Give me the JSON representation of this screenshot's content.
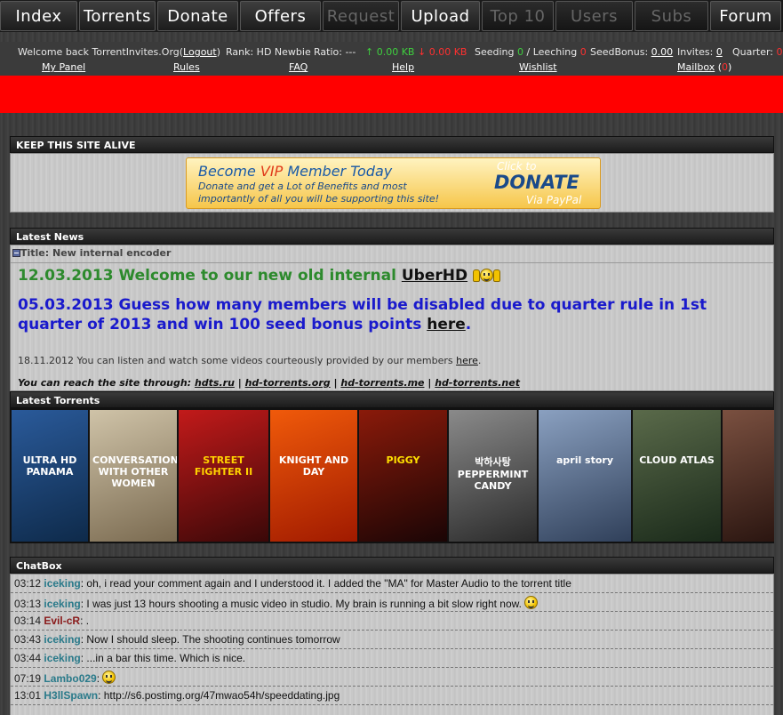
{
  "nav": {
    "tabs": [
      {
        "label": "Index",
        "dim": false
      },
      {
        "label": "Torrents",
        "dim": false
      },
      {
        "label": "Donate",
        "dim": false
      },
      {
        "label": "Offers",
        "dim": false
      },
      {
        "label": "Request",
        "dim": true
      },
      {
        "label": "Upload",
        "dim": false
      },
      {
        "label": "Top 10",
        "dim": true
      },
      {
        "label": "Users",
        "dim": true
      },
      {
        "label": "Subs",
        "dim": true
      },
      {
        "label": "Forum",
        "dim": false
      }
    ]
  },
  "userbar": {
    "welcome": "Welcome back TorrentInvites.Org(",
    "logout": "Logout",
    "welcome_end": ")",
    "my_panel": "My Panel",
    "rank": "Rank: HD Newbie",
    "rules": "Rules",
    "ratio": "Ratio: ---",
    "faq": "FAQ",
    "upload": "↑ 0.00 KB",
    "help": "Help",
    "download": "↓ 0.00 KB",
    "seeding_label": "Seeding",
    "seeding_value": "0",
    "leeching_label": "/ Leeching",
    "leeching_value": "0",
    "wishlist": "Wishlist",
    "seedbonus_label": "SeedBonus:",
    "seedbonus_value": "0.00",
    "invites_label": "Invites:",
    "invites_value": "0",
    "mailbox": "Mailbox",
    "mailbox_count": "0",
    "quarter_label": "Quarter:",
    "quarter_value": "0"
  },
  "keepalive": {
    "header": "KEEP THIS SITE ALIVE",
    "vip_prefix": "Become ",
    "vip_word": "VIP",
    "vip_suffix": " Member Today",
    "vip_text": "Donate and get a Lot of Benefits and most importantly of all you will be supporting this site!",
    "click_to": "Click to",
    "donate": "DONATE",
    "via_paypal": "Via PayPal"
  },
  "news": {
    "header": "Latest News",
    "title_label": "Title: New internal encoder",
    "line1_text": "12.03.2013 Welcome to our new old internal ",
    "line1_link": "UberHD",
    "line2_text": "05.03.2013 Guess how many members will be disabled due to quarter rule in 1st quarter of 2013 and win 100 seed bonus points ",
    "line2_link": "here",
    "line2_end": ".",
    "line3_text": "18.11.2012 You can listen and watch some videos courteously provided by our members ",
    "line3_link": "here",
    "line3_end": ".",
    "reach_label": "You can reach the site through: ",
    "reach_links": [
      "hdts.ru",
      "hd-torrents.org",
      "hd-torrents.me",
      "hd-torrents.net"
    ],
    "separator": " | "
  },
  "torrents": {
    "header": "Latest Torrents",
    "posters": [
      {
        "title": "ULTRA HD PANAMA",
        "colors": [
          "#2a5a9a",
          "#0e2a4a"
        ],
        "text_color": "#ffffff"
      },
      {
        "title": "CONVERSATION(S) WITH OTHER WOMEN",
        "colors": [
          "#cfc3a8",
          "#7a6a50"
        ],
        "text_color": "#ffffff"
      },
      {
        "title": "STREET FIGHTER II",
        "colors": [
          "#c21a1a",
          "#3a0808"
        ],
        "text_color": "#ffd200"
      },
      {
        "title": "KNIGHT AND DAY",
        "colors": [
          "#f05a0a",
          "#a01a00"
        ],
        "text_color": "#ffffff"
      },
      {
        "title": "PIGGY",
        "colors": [
          "#8a1a0a",
          "#1a0505"
        ],
        "text_color": "#ffe000"
      },
      {
        "title": "박하사탕 PEPPERMINT CANDY",
        "colors": [
          "#8a8a8a",
          "#2a2a2a"
        ],
        "text_color": "#ffffff"
      },
      {
        "title": "april story",
        "colors": [
          "#8aa0c0",
          "#30405a"
        ],
        "text_color": "#ffffff"
      },
      {
        "title": "CLOUD ATLAS",
        "colors": [
          "#5a6a4a",
          "#1a2a1a"
        ],
        "text_color": "#ffffff"
      },
      {
        "title": "",
        "colors": [
          "#7a5040",
          "#2a1510"
        ],
        "text_color": "#ffffff"
      }
    ]
  },
  "chat": {
    "header": "ChatBox",
    "messages": [
      {
        "time": "03:12",
        "user": "iceking",
        "msg": "oh, i read your comment again and I understood it. I added the \"MA\" for Master Audio to the torrent title",
        "smiley": false,
        "color": "teal"
      },
      {
        "time": "03:13",
        "user": "iceking",
        "msg": "I was just 13 hours shooting a music video in studio. My brain is running a bit slow right now.",
        "smiley": true,
        "color": "teal"
      },
      {
        "time": "03:14",
        "user": "Evil-cR",
        "msg": ".",
        "smiley": false,
        "color": "red"
      },
      {
        "time": "03:43",
        "user": "iceking",
        "msg": "Now I should sleep. The shooting continues tomorrow",
        "smiley": false,
        "color": "teal"
      },
      {
        "time": "03:44",
        "user": "iceking",
        "msg": "...in a bar this time. Which is nice.",
        "smiley": false,
        "color": "teal"
      },
      {
        "time": "07:19",
        "user": "Lambo029",
        "msg": "",
        "smiley": true,
        "color": "teal"
      },
      {
        "time": "13:01",
        "user": "H3llSpawn",
        "msg": "http://s6.postimg.org/47mwao54h/speeddating.jpg",
        "smiley": false,
        "color": "teal"
      }
    ]
  }
}
